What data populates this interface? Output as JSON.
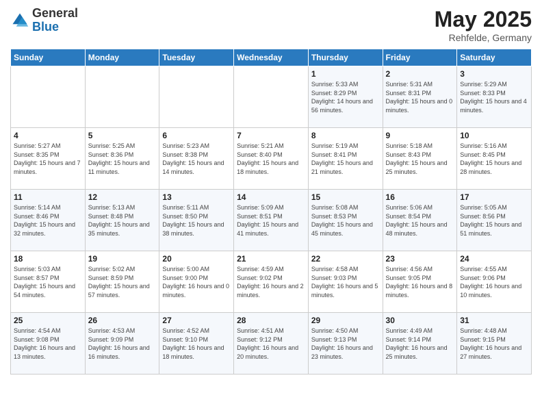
{
  "header": {
    "logo_general": "General",
    "logo_blue": "Blue",
    "title": "May 2025",
    "subtitle": "Rehfelde, Germany"
  },
  "weekdays": [
    "Sunday",
    "Monday",
    "Tuesday",
    "Wednesday",
    "Thursday",
    "Friday",
    "Saturday"
  ],
  "weeks": [
    [
      {
        "day": "",
        "sunrise": "",
        "sunset": "",
        "daylight": ""
      },
      {
        "day": "",
        "sunrise": "",
        "sunset": "",
        "daylight": ""
      },
      {
        "day": "",
        "sunrise": "",
        "sunset": "",
        "daylight": ""
      },
      {
        "day": "",
        "sunrise": "",
        "sunset": "",
        "daylight": ""
      },
      {
        "day": "1",
        "sunrise": "Sunrise: 5:33 AM",
        "sunset": "Sunset: 8:29 PM",
        "daylight": "Daylight: 14 hours and 56 minutes."
      },
      {
        "day": "2",
        "sunrise": "Sunrise: 5:31 AM",
        "sunset": "Sunset: 8:31 PM",
        "daylight": "Daylight: 15 hours and 0 minutes."
      },
      {
        "day": "3",
        "sunrise": "Sunrise: 5:29 AM",
        "sunset": "Sunset: 8:33 PM",
        "daylight": "Daylight: 15 hours and 4 minutes."
      }
    ],
    [
      {
        "day": "4",
        "sunrise": "Sunrise: 5:27 AM",
        "sunset": "Sunset: 8:35 PM",
        "daylight": "Daylight: 15 hours and 7 minutes."
      },
      {
        "day": "5",
        "sunrise": "Sunrise: 5:25 AM",
        "sunset": "Sunset: 8:36 PM",
        "daylight": "Daylight: 15 hours and 11 minutes."
      },
      {
        "day": "6",
        "sunrise": "Sunrise: 5:23 AM",
        "sunset": "Sunset: 8:38 PM",
        "daylight": "Daylight: 15 hours and 14 minutes."
      },
      {
        "day": "7",
        "sunrise": "Sunrise: 5:21 AM",
        "sunset": "Sunset: 8:40 PM",
        "daylight": "Daylight: 15 hours and 18 minutes."
      },
      {
        "day": "8",
        "sunrise": "Sunrise: 5:19 AM",
        "sunset": "Sunset: 8:41 PM",
        "daylight": "Daylight: 15 hours and 21 minutes."
      },
      {
        "day": "9",
        "sunrise": "Sunrise: 5:18 AM",
        "sunset": "Sunset: 8:43 PM",
        "daylight": "Daylight: 15 hours and 25 minutes."
      },
      {
        "day": "10",
        "sunrise": "Sunrise: 5:16 AM",
        "sunset": "Sunset: 8:45 PM",
        "daylight": "Daylight: 15 hours and 28 minutes."
      }
    ],
    [
      {
        "day": "11",
        "sunrise": "Sunrise: 5:14 AM",
        "sunset": "Sunset: 8:46 PM",
        "daylight": "Daylight: 15 hours and 32 minutes."
      },
      {
        "day": "12",
        "sunrise": "Sunrise: 5:13 AM",
        "sunset": "Sunset: 8:48 PM",
        "daylight": "Daylight: 15 hours and 35 minutes."
      },
      {
        "day": "13",
        "sunrise": "Sunrise: 5:11 AM",
        "sunset": "Sunset: 8:50 PM",
        "daylight": "Daylight: 15 hours and 38 minutes."
      },
      {
        "day": "14",
        "sunrise": "Sunrise: 5:09 AM",
        "sunset": "Sunset: 8:51 PM",
        "daylight": "Daylight: 15 hours and 41 minutes."
      },
      {
        "day": "15",
        "sunrise": "Sunrise: 5:08 AM",
        "sunset": "Sunset: 8:53 PM",
        "daylight": "Daylight: 15 hours and 45 minutes."
      },
      {
        "day": "16",
        "sunrise": "Sunrise: 5:06 AM",
        "sunset": "Sunset: 8:54 PM",
        "daylight": "Daylight: 15 hours and 48 minutes."
      },
      {
        "day": "17",
        "sunrise": "Sunrise: 5:05 AM",
        "sunset": "Sunset: 8:56 PM",
        "daylight": "Daylight: 15 hours and 51 minutes."
      }
    ],
    [
      {
        "day": "18",
        "sunrise": "Sunrise: 5:03 AM",
        "sunset": "Sunset: 8:57 PM",
        "daylight": "Daylight: 15 hours and 54 minutes."
      },
      {
        "day": "19",
        "sunrise": "Sunrise: 5:02 AM",
        "sunset": "Sunset: 8:59 PM",
        "daylight": "Daylight: 15 hours and 57 minutes."
      },
      {
        "day": "20",
        "sunrise": "Sunrise: 5:00 AM",
        "sunset": "Sunset: 9:00 PM",
        "daylight": "Daylight: 16 hours and 0 minutes."
      },
      {
        "day": "21",
        "sunrise": "Sunrise: 4:59 AM",
        "sunset": "Sunset: 9:02 PM",
        "daylight": "Daylight: 16 hours and 2 minutes."
      },
      {
        "day": "22",
        "sunrise": "Sunrise: 4:58 AM",
        "sunset": "Sunset: 9:03 PM",
        "daylight": "Daylight: 16 hours and 5 minutes."
      },
      {
        "day": "23",
        "sunrise": "Sunrise: 4:56 AM",
        "sunset": "Sunset: 9:05 PM",
        "daylight": "Daylight: 16 hours and 8 minutes."
      },
      {
        "day": "24",
        "sunrise": "Sunrise: 4:55 AM",
        "sunset": "Sunset: 9:06 PM",
        "daylight": "Daylight: 16 hours and 10 minutes."
      }
    ],
    [
      {
        "day": "25",
        "sunrise": "Sunrise: 4:54 AM",
        "sunset": "Sunset: 9:08 PM",
        "daylight": "Daylight: 16 hours and 13 minutes."
      },
      {
        "day": "26",
        "sunrise": "Sunrise: 4:53 AM",
        "sunset": "Sunset: 9:09 PM",
        "daylight": "Daylight: 16 hours and 16 minutes."
      },
      {
        "day": "27",
        "sunrise": "Sunrise: 4:52 AM",
        "sunset": "Sunset: 9:10 PM",
        "daylight": "Daylight: 16 hours and 18 minutes."
      },
      {
        "day": "28",
        "sunrise": "Sunrise: 4:51 AM",
        "sunset": "Sunset: 9:12 PM",
        "daylight": "Daylight: 16 hours and 20 minutes."
      },
      {
        "day": "29",
        "sunrise": "Sunrise: 4:50 AM",
        "sunset": "Sunset: 9:13 PM",
        "daylight": "Daylight: 16 hours and 23 minutes."
      },
      {
        "day": "30",
        "sunrise": "Sunrise: 4:49 AM",
        "sunset": "Sunset: 9:14 PM",
        "daylight": "Daylight: 16 hours and 25 minutes."
      },
      {
        "day": "31",
        "sunrise": "Sunrise: 4:48 AM",
        "sunset": "Sunset: 9:15 PM",
        "daylight": "Daylight: 16 hours and 27 minutes."
      }
    ]
  ]
}
